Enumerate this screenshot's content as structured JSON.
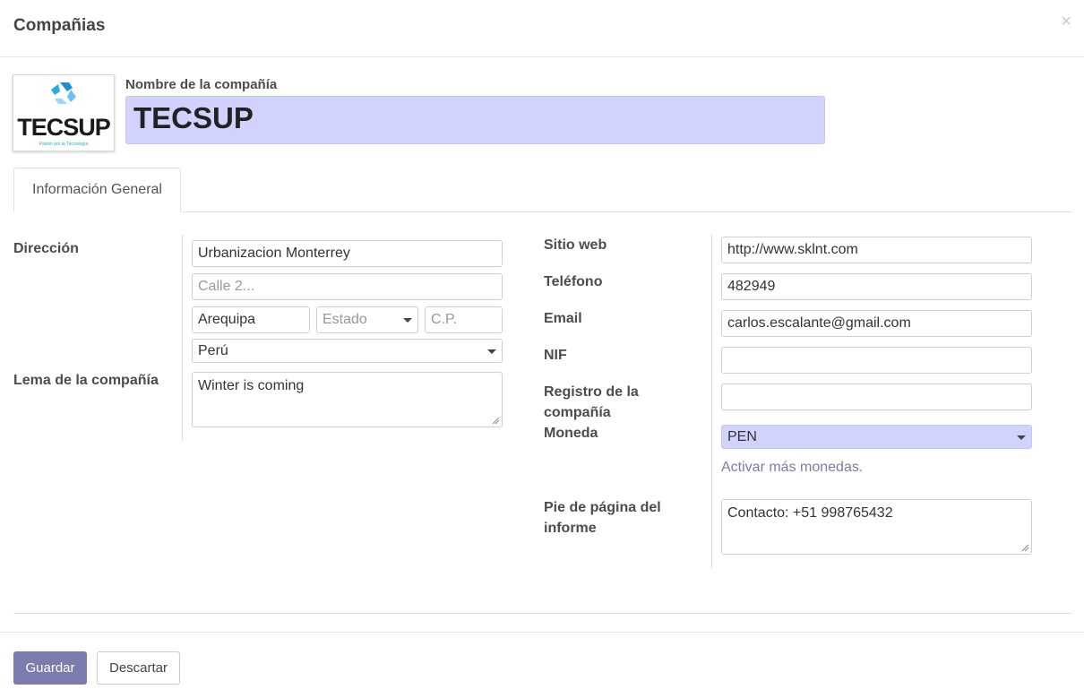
{
  "header": {
    "title": "Compañias",
    "close_label": "×"
  },
  "logo": {
    "alt": "TECSUP",
    "text": "TECSUP",
    "tagline": "Pasión por la Tecnología"
  },
  "company_name": {
    "label": "Nombre de la compañía",
    "value": "TECSUP"
  },
  "tabs": [
    {
      "label": "Información General"
    }
  ],
  "left": {
    "address_label": "Dirección",
    "street": "Urbanizacion Monterrey",
    "street2_placeholder": "Calle 2...",
    "city": "Arequipa",
    "state_placeholder": "Estado",
    "zip_placeholder": "C.P.",
    "country": "Perú",
    "tagline_label": "Lema de la compañía",
    "tagline": "Winter is coming"
  },
  "right": {
    "website_label": "Sitio web",
    "website": "http://www.sklnt.com",
    "phone_label": "Teléfono",
    "phone": "482949",
    "email_label": "Email",
    "email": "carlos.escalante@gmail.com",
    "vat_label": "NIF",
    "vat": "",
    "registry_label": "Registro de la compañía",
    "registry": "",
    "currency_label": "Moneda",
    "currency": "PEN",
    "more_currencies_link": "Activar más monedas.",
    "footer_label": "Pie de página del informe",
    "footer": "Contacto: +51 998765432"
  },
  "footer": {
    "save_label": "Guardar",
    "discard_label": "Descartar"
  },
  "colors": {
    "primary": "#7c7bad",
    "highlight": "#d2d2ff",
    "logo_blue": "#29a9e0",
    "logo_text": "#1a1a1a"
  }
}
